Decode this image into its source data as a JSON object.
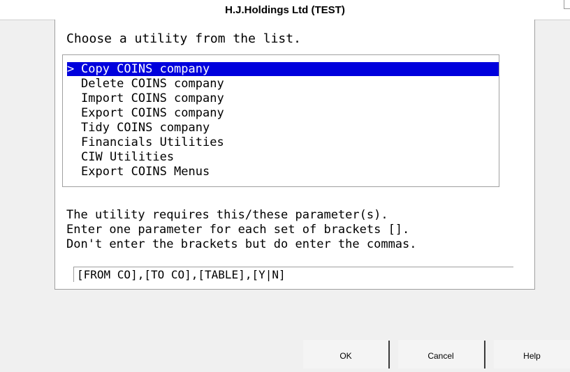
{
  "window": {
    "title": "H.J.Holdings Ltd (TEST)"
  },
  "prompt": "Choose a utility from the list.",
  "utilities": {
    "selected_marker": ">",
    "items": [
      {
        "label": "Copy COINS company",
        "selected": true
      },
      {
        "label": "Delete COINS company",
        "selected": false
      },
      {
        "label": "Import COINS company",
        "selected": false
      },
      {
        "label": "Export COINS company",
        "selected": false
      },
      {
        "label": "Tidy COINS company",
        "selected": false
      },
      {
        "label": "Financials Utilities",
        "selected": false
      },
      {
        "label": "CIW Utilities",
        "selected": false
      },
      {
        "label": "Export COINS Menus",
        "selected": false
      }
    ]
  },
  "parameters": {
    "line1": "The utility requires this/these parameter(s).",
    "line2": "Enter one parameter for each set of brackets [].",
    "line3": "Don't enter the brackets but do enter the commas.",
    "input_value": "[FROM CO],[TO CO],[TABLE],[Y|N]"
  },
  "buttons": {
    "ok": "OK",
    "cancel": "Cancel",
    "help": "Help"
  },
  "colors": {
    "selection": "#0000dd",
    "scrollbar": "#0000dd"
  }
}
